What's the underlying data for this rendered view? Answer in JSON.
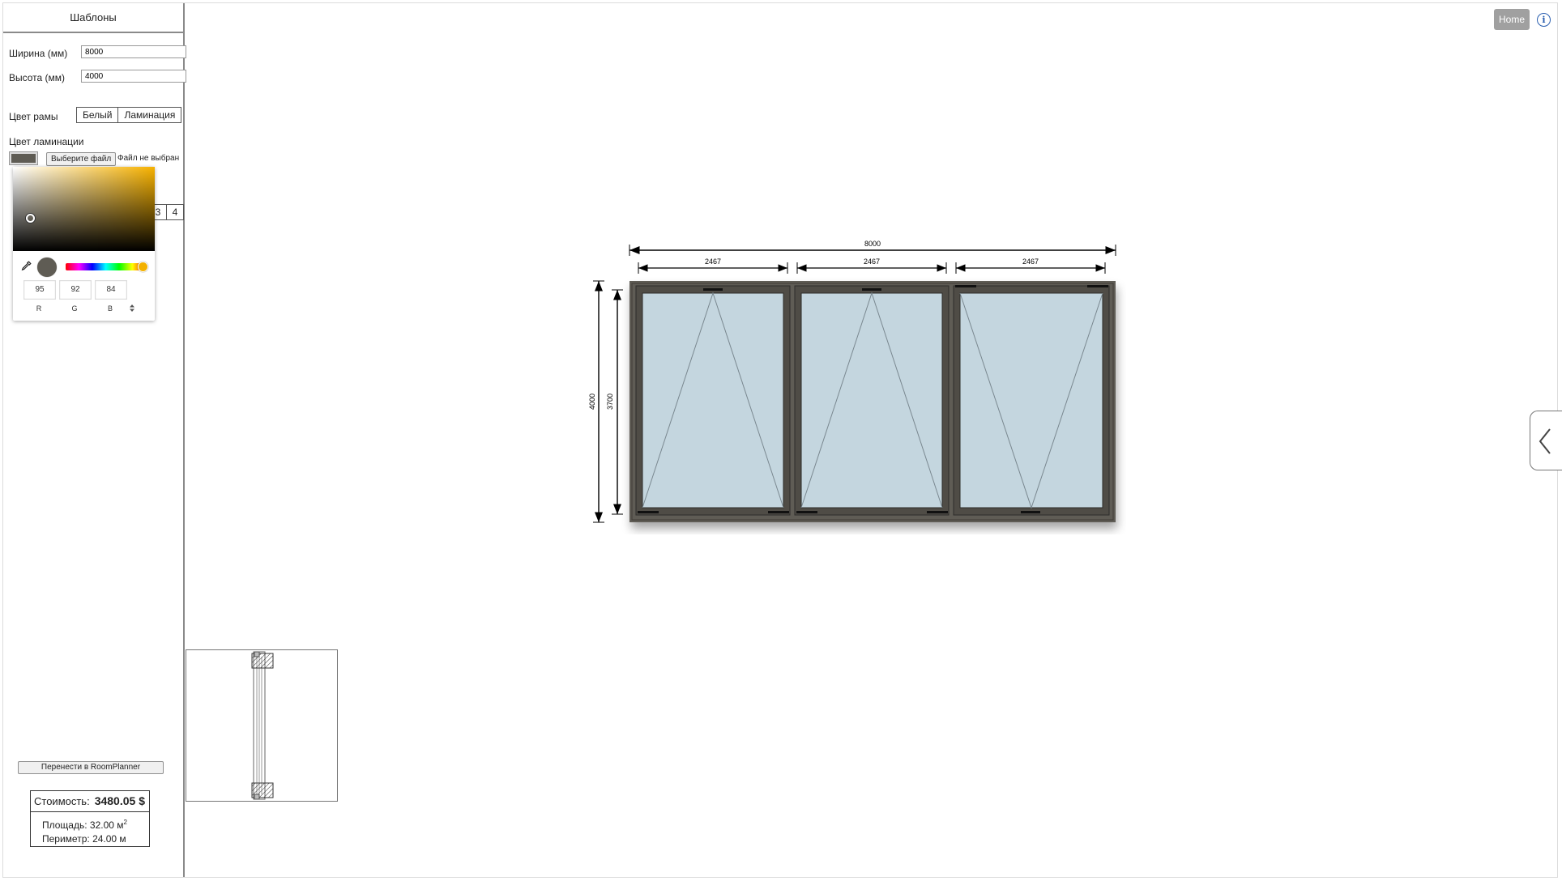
{
  "sidebar": {
    "header": "Шаблоны",
    "width_label": "Ширина (мм)",
    "width_value": "8000",
    "height_label": "Высота (мм)",
    "height_value": "4000",
    "frame_color_label": "Цвет рамы",
    "frame_color_options": [
      "Белый",
      "Ламинация"
    ],
    "lamination_label": "Цвет ламинации",
    "file_button": "Выберите файл",
    "file_status": "Файл не выбран",
    "hidden_segment_last": "4",
    "lamination_color": "#5f5c54"
  },
  "color_picker": {
    "eyedropper_icon": "eyedropper-icon",
    "r": "95",
    "g": "92",
    "b": "84",
    "r_label": "R",
    "g_label": "G",
    "b_label": "B",
    "toggle_icon": "up-down-arrows-icon",
    "hue_color": "#f3b100"
  },
  "actions": {
    "roomplanner_button": "Перенести в RoomPlanner"
  },
  "summary": {
    "cost_label": "Стоимость:",
    "cost_value": "3480.05 $",
    "area_label": "Площадь:",
    "area_value": "32.00 м",
    "area_sup": "2",
    "perimeter_label": "Периметр:",
    "perimeter_value": "24.00 м"
  },
  "topbar": {
    "home_button": "Home",
    "info_icon": "info-icon",
    "side_tab_icon": "chevron-left-icon"
  },
  "window_drawing": {
    "overall_width": "8000",
    "overall_height": "4000",
    "sash_height": "3700",
    "sash_widths": [
      "2467",
      "2467",
      "2467"
    ],
    "sash_openings": [
      "tilt",
      "tilt",
      "tilt-inverted"
    ],
    "frame_color": "#5f5c54",
    "glass_color": "#c4d6df"
  }
}
